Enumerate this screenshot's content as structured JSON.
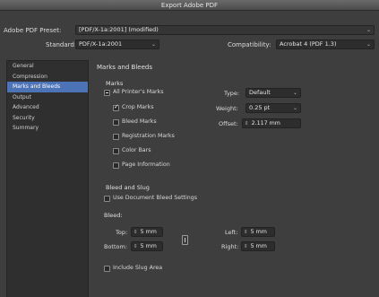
{
  "window": {
    "title": "Export Adobe PDF"
  },
  "preset": {
    "label": "Adobe PDF Preset:",
    "value": "[PDF/X-1a:2001] (modified)"
  },
  "standard": {
    "label": "Standard:",
    "value": "PDF/X-1a:2001"
  },
  "compatibility": {
    "label": "Compatibility:",
    "value": "Acrobat 4 (PDF 1.3)"
  },
  "sidebar": {
    "items": [
      {
        "label": "General"
      },
      {
        "label": "Compression"
      },
      {
        "label": "Marks and Bleeds"
      },
      {
        "label": "Output"
      },
      {
        "label": "Advanced"
      },
      {
        "label": "Security"
      },
      {
        "label": "Summary"
      }
    ],
    "active_index": 2
  },
  "panel": {
    "title": "Marks and Bleeds",
    "marks": {
      "heading": "Marks",
      "all_printers_marks": "All Printer's Marks",
      "crop_marks": "Crop Marks",
      "bleed_marks": "Bleed Marks",
      "registration_marks": "Registration Marks",
      "color_bars": "Color Bars",
      "page_information": "Page Information",
      "type_label": "Type:",
      "type_value": "Default",
      "weight_label": "Weight:",
      "weight_value": "0.25 pt",
      "offset_label": "Offset:",
      "offset_value": "2.117 mm"
    },
    "bleed_slug": {
      "heading": "Bleed and Slug",
      "use_document_bleed": "Use Document Bleed Settings",
      "bleed_heading": "Bleed:",
      "top_label": "Top:",
      "top_value": "5 mm",
      "bottom_label": "Bottom:",
      "bottom_value": "5 mm",
      "left_label": "Left:",
      "left_value": "5 mm",
      "right_label": "Right:",
      "right_value": "5 mm",
      "include_slug": "Include Slug Area"
    }
  },
  "colors": {
    "accent": "#4d73b7",
    "background": "#3e3e3e",
    "field": "#2d2d2d"
  }
}
